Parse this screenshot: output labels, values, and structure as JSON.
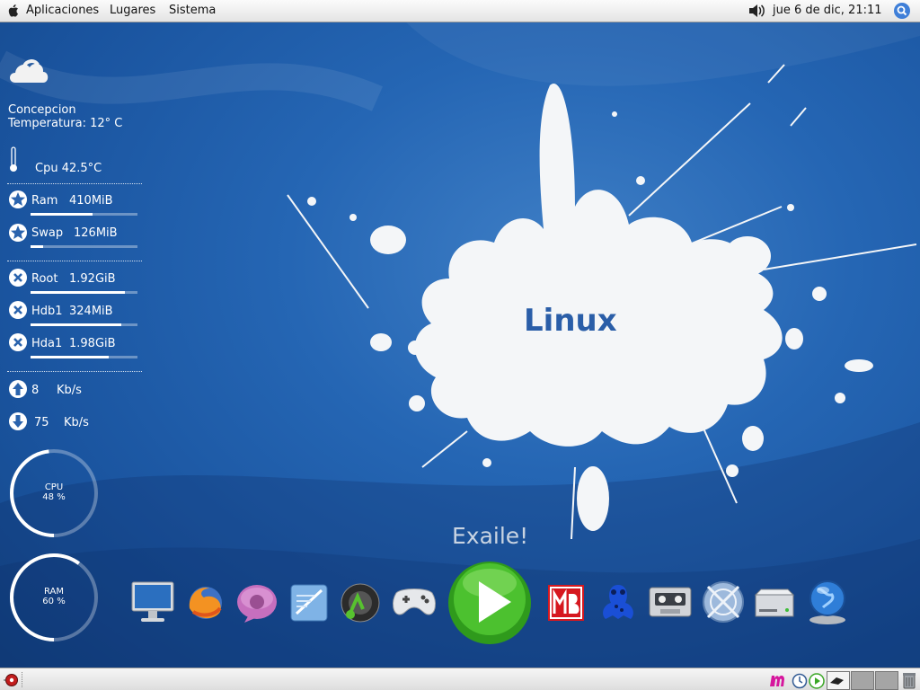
{
  "top_panel": {
    "menu_items": [
      "Aplicaciones",
      "Lugares",
      "Sistema"
    ],
    "clock": "jue  6 de dic, 21:11"
  },
  "conky": {
    "weather_icon": "cloud-icon",
    "city": "Concepcion",
    "temperature": "Temperatura: 12° C",
    "cpu_temp": "Cpu 42.5°C",
    "ram": {
      "label": "Ram",
      "value": "410MiB",
      "bar": 0.58
    },
    "swap": {
      "label": "Swap",
      "value": "126MiB",
      "bar": 0.12
    },
    "disks": [
      {
        "label": "Root",
        "value": "1.92GiB",
        "bar": 0.88
      },
      {
        "label": "Hdb1",
        "value": "324MiB",
        "bar": 0.85
      },
      {
        "label": "Hda1",
        "value": "1.98GiB",
        "bar": 0.73
      }
    ],
    "upload": {
      "value": "8",
      "unit": "Kb/s"
    },
    "download": {
      "value": "75",
      "unit": "Kb/s"
    },
    "cpu_ring": {
      "label": "CPU",
      "value": "48 %",
      "level": 0.48
    },
    "ram_ring": {
      "label": "RAM",
      "value": "60 %",
      "level": 0.6
    }
  },
  "wallpaper": {
    "logo_text": "Linux"
  },
  "dock": {
    "active_label": "Exaile!",
    "items": [
      {
        "name": "computer-icon"
      },
      {
        "name": "firefox-icon"
      },
      {
        "name": "pidgin-icon"
      },
      {
        "name": "office-writer-icon"
      },
      {
        "name": "media-player-icon"
      },
      {
        "name": "gamepad-icon"
      },
      {
        "name": "exaile-play-icon"
      },
      {
        "name": "mb-icon"
      },
      {
        "name": "frog-icon"
      },
      {
        "name": "cassette-icon"
      },
      {
        "name": "crossover-icon"
      },
      {
        "name": "drive-icon"
      },
      {
        "name": "network-globe-icon"
      }
    ]
  },
  "colors": {
    "desktop": "#2566b4",
    "panel": "#e8e8e8",
    "dock_green": "#3aa625"
  }
}
